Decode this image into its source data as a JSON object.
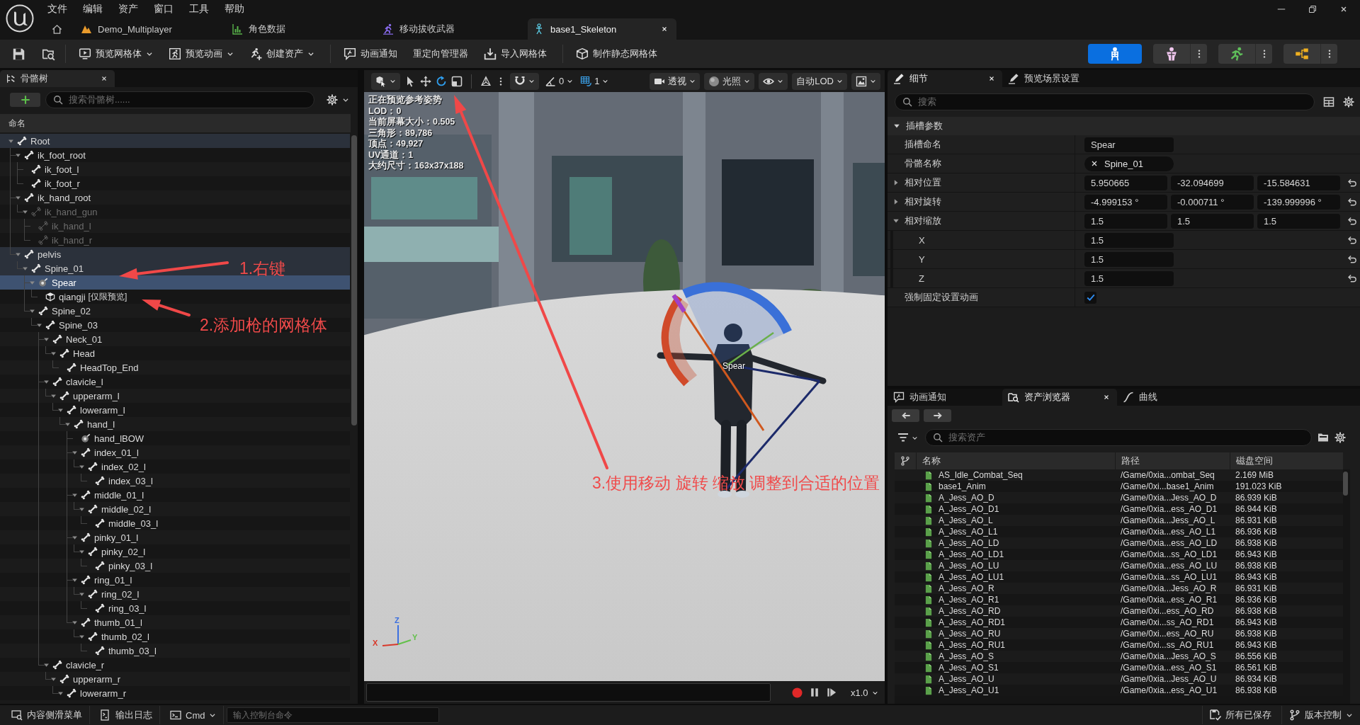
{
  "title_bar": {
    "menu": [
      "文件",
      "编辑",
      "资产",
      "窗口",
      "工具",
      "帮助"
    ],
    "tabs": [
      {
        "label": "Demo_Multiplayer",
        "kind": "level",
        "selected": false
      },
      {
        "label": "角色数据",
        "kind": "data",
        "selected": false
      },
      {
        "label": "移动拔收武器",
        "kind": "animation",
        "selected": false
      },
      {
        "label": "base1_Skeleton",
        "kind": "skeleton",
        "selected": true
      }
    ]
  },
  "toolbar": {
    "groups": [
      [
        {
          "label": "预览网格体",
          "kind": "mesh",
          "dropdown": true
        },
        {
          "label": "预览动画",
          "kind": "animation",
          "dropdown": true
        },
        {
          "label": "创建资产",
          "kind": "create",
          "dropdown": true
        }
      ],
      [
        {
          "label": "动画通知",
          "kind": "notify",
          "dropdown": false
        },
        {
          "label": "重定向管理器",
          "kind": "plain",
          "dropdown": false
        },
        {
          "label": "导入网格体",
          "kind": "import",
          "dropdown": false
        }
      ],
      [
        {
          "label": "制作静态网格体",
          "kind": "static",
          "dropdown": false
        }
      ]
    ],
    "modes": [
      {
        "kind": "skeleton",
        "selected": true
      },
      {
        "kind": "mesh",
        "selected": false
      },
      {
        "kind": "animation",
        "selected": false
      },
      {
        "kind": "blueprint",
        "selected": false
      }
    ]
  },
  "skeleton_tree": {
    "tab": "骨骼树",
    "search": {
      "placeholder": "搜索骨骼树......"
    },
    "column": "命名",
    "nodes": [
      {
        "name": "Root",
        "kind": "bone",
        "greyed": false,
        "selected": false,
        "expanded": true,
        "children": [
          {
            "name": "ik_foot_root",
            "kind": "bone",
            "greyed": false,
            "selected": false,
            "expanded": true,
            "children": [
              {
                "name": "ik_foot_l",
                "kind": "bone",
                "greyed": false,
                "selected": false
              },
              {
                "name": "ik_foot_r",
                "kind": "bone",
                "greyed": false,
                "selected": false
              }
            ]
          },
          {
            "name": "ik_hand_root",
            "kind": "bone",
            "greyed": false,
            "selected": false,
            "expanded": true,
            "children": [
              {
                "name": "ik_hand_gun",
                "kind": "bone",
                "greyed": true,
                "selected": false,
                "expanded": true,
                "children": [
                  {
                    "name": "ik_hand_l",
                    "kind": "bone",
                    "greyed": true,
                    "selected": false
                  },
                  {
                    "name": "ik_hand_r",
                    "kind": "bone",
                    "greyed": true,
                    "selected": false
                  }
                ]
              }
            ]
          },
          {
            "name": "pelvis",
            "kind": "bone",
            "greyed": false,
            "selected": false,
            "expanded": true,
            "children": [
              {
                "name": "Spine_01",
                "kind": "bone",
                "greyed": false,
                "selected": false,
                "expanded": true,
                "children": [
                  {
                    "name": "Spear",
                    "kind": "socket",
                    "greyed": false,
                    "selected": true,
                    "expanded": true,
                    "children": [
                      {
                        "name": "qiangji",
                        "tag": "[仅限预览]",
                        "kind": "mesh",
                        "greyed": false,
                        "selected": false
                      }
                    ]
                  },
                  {
                    "name": "Spine_02",
                    "kind": "bone",
                    "greyed": false,
                    "selected": false,
                    "expanded": true,
                    "children": [
                      {
                        "name": "Spine_03",
                        "kind": "bone",
                        "greyed": false,
                        "selected": false,
                        "expanded": true,
                        "children": [
                          {
                            "name": "Neck_01",
                            "kind": "bone",
                            "greyed": false,
                            "selected": false,
                            "expanded": true,
                            "children": [
                              {
                                "name": "Head",
                                "kind": "bone",
                                "greyed": false,
                                "selected": false,
                                "expanded": true,
                                "children": [
                                  {
                                    "name": "HeadTop_End",
                                    "kind": "bone",
                                    "greyed": false,
                                    "selected": false
                                  }
                                ]
                              }
                            ]
                          },
                          {
                            "name": "clavicle_l",
                            "kind": "bone",
                            "greyed": false,
                            "selected": false,
                            "expanded": true,
                            "children": [
                              {
                                "name": "upperarm_l",
                                "kind": "bone",
                                "greyed": false,
                                "selected": false,
                                "expanded": true,
                                "children": [
                                  {
                                    "name": "lowerarm_l",
                                    "kind": "bone",
                                    "greyed": false,
                                    "selected": false,
                                    "expanded": true,
                                    "children": [
                                      {
                                        "name": "hand_l",
                                        "kind": "bone",
                                        "greyed": false,
                                        "selected": false,
                                        "expanded": true,
                                        "children": [
                                          {
                                            "name": "hand_lBOW",
                                            "kind": "socket",
                                            "greyed": false,
                                            "selected": false
                                          },
                                          {
                                            "name": "index_01_l",
                                            "kind": "bone",
                                            "greyed": false,
                                            "selected": false,
                                            "expanded": true,
                                            "children": [
                                              {
                                                "name": "index_02_l",
                                                "kind": "bone",
                                                "greyed": false,
                                                "selected": false,
                                                "expanded": true,
                                                "children": [
                                                  {
                                                    "name": "index_03_l",
                                                    "kind": "bone",
                                                    "greyed": false,
                                                    "selected": false
                                                  }
                                                ]
                                              }
                                            ]
                                          },
                                          {
                                            "name": "middle_01_l",
                                            "kind": "bone",
                                            "greyed": false,
                                            "selected": false,
                                            "expanded": true,
                                            "children": [
                                              {
                                                "name": "middle_02_l",
                                                "kind": "bone",
                                                "greyed": false,
                                                "selected": false,
                                                "expanded": true,
                                                "children": [
                                                  {
                                                    "name": "middle_03_l",
                                                    "kind": "bone",
                                                    "greyed": false,
                                                    "selected": false
                                                  }
                                                ]
                                              }
                                            ]
                                          },
                                          {
                                            "name": "pinky_01_l",
                                            "kind": "bone",
                                            "greyed": false,
                                            "selected": false,
                                            "expanded": true,
                                            "children": [
                                              {
                                                "name": "pinky_02_l",
                                                "kind": "bone",
                                                "greyed": false,
                                                "selected": false,
                                                "expanded": true,
                                                "children": [
                                                  {
                                                    "name": "pinky_03_l",
                                                    "kind": "bone",
                                                    "greyed": false,
                                                    "selected": false
                                                  }
                                                ]
                                              }
                                            ]
                                          },
                                          {
                                            "name": "ring_01_l",
                                            "kind": "bone",
                                            "greyed": false,
                                            "selected": false,
                                            "expanded": true,
                                            "children": [
                                              {
                                                "name": "ring_02_l",
                                                "kind": "bone",
                                                "greyed": false,
                                                "selected": false,
                                                "expanded": true,
                                                "children": [
                                                  {
                                                    "name": "ring_03_l",
                                                    "kind": "bone",
                                                    "greyed": false,
                                                    "selected": false
                                                  }
                                                ]
                                              }
                                            ]
                                          },
                                          {
                                            "name": "thumb_01_l",
                                            "kind": "bone",
                                            "greyed": false,
                                            "selected": false,
                                            "expanded": true,
                                            "children": [
                                              {
                                                "name": "thumb_02_l",
                                                "kind": "bone",
                                                "greyed": false,
                                                "selected": false,
                                                "expanded": true,
                                                "children": [
                                                  {
                                                    "name": "thumb_03_l",
                                                    "kind": "bone",
                                                    "greyed": false,
                                                    "selected": false
                                                  }
                                                ]
                                              }
                                            ]
                                          }
                                        ]
                                      }
                                    ]
                                  }
                                ]
                              }
                            ]
                          },
                          {
                            "name": "clavicle_r",
                            "kind": "bone",
                            "greyed": false,
                            "selected": false,
                            "expanded": true,
                            "children": [
                              {
                                "name": "upperarm_r",
                                "kind": "bone",
                                "greyed": false,
                                "selected": false,
                                "expanded": true,
                                "children": [
                                  {
                                    "name": "lowerarm_r",
                                    "kind": "bone",
                                    "greyed": false,
                                    "selected": false,
                                    "expanded": true
                                  }
                                ]
                              }
                            ]
                          }
                        ]
                      }
                    ]
                  }
                ]
              }
            ]
          }
        ]
      }
    ]
  },
  "viewport": {
    "tools": [
      {
        "kind": "select",
        "selected": false
      },
      {
        "kind": "move",
        "selected": false
      },
      {
        "kind": "rotate",
        "selected": true
      },
      {
        "kind": "scale",
        "selected": false
      }
    ],
    "angle_snap": "0",
    "grid_snap": "1",
    "view_buttons": [
      {
        "kind": "camera",
        "label": "透视"
      },
      {
        "kind": "lighting",
        "label": "光照"
      },
      {
        "kind": "show"
      },
      {
        "kind": "lod",
        "label": "自动LOD"
      },
      {
        "kind": "screen"
      }
    ],
    "stats": [
      "正在预览参考姿势",
      "LOD：0",
      "当前屏幕大小：0.505",
      "三角形：89,786",
      "顶点：49,927",
      "UV通道：1",
      "大约尺寸：163x37x188"
    ],
    "socket_label": "Spear",
    "axes": [
      {
        "label": "Z",
        "color": "#3b6fe0"
      },
      {
        "label": "X",
        "color": "#d8382a"
      },
      {
        "label": "Y",
        "color": "#62c04a"
      }
    ],
    "playback": {
      "speed": "x1.0"
    }
  },
  "details": {
    "tabs": [
      {
        "label": "细节",
        "selected": true
      },
      {
        "label": "预览场景设置",
        "selected": false
      }
    ],
    "search": {
      "placeholder": "搜索"
    },
    "section": {
      "title": "插槽参数",
      "expanded": true
    },
    "properties": [
      {
        "kind": "text",
        "label": "插槽命名",
        "value": "Spear",
        "modified": false
      },
      {
        "kind": "bone",
        "label": "骨骼名称",
        "value": "Spine_01",
        "modified": false
      },
      {
        "kind": "vector",
        "label": "相对位置",
        "expanded": false,
        "values": [
          "5.950665",
          "-32.094699",
          "-15.584631"
        ],
        "modified": true
      },
      {
        "kind": "vector",
        "label": "相对旋转",
        "expanded": false,
        "values": [
          "-4.999153 °",
          "-0.000711 °",
          "-139.999996 °"
        ],
        "modified": true
      },
      {
        "kind": "vector",
        "label": "相对缩放",
        "expanded": true,
        "values": [
          "1.5",
          "1.5",
          "1.5"
        ],
        "modified": true,
        "children": [
          {
            "kind": "scalar",
            "label": "X",
            "value": "1.5",
            "modified": true
          },
          {
            "kind": "scalar",
            "label": "Y",
            "value": "1.5",
            "modified": true
          },
          {
            "kind": "scalar",
            "label": "Z",
            "value": "1.5",
            "modified": true
          }
        ]
      },
      {
        "kind": "checkbox",
        "label": "强制固定设置动画",
        "checked": true,
        "modified": false
      }
    ]
  },
  "asset_browser": {
    "tabs": [
      {
        "label": "动画通知",
        "kind": "notify",
        "selected": false
      },
      {
        "label": "资产浏览器",
        "kind": "browser",
        "selected": true
      },
      {
        "label": "曲线",
        "kind": "curve",
        "selected": false
      }
    ],
    "search": {
      "placeholder": "搜索资产"
    },
    "columns": [
      "名称",
      "路径",
      "磁盘空间"
    ],
    "rows": [
      {
        "name": "AS_Idle_Combat_Seq",
        "path": "/Game/0xia...ombat_Seq",
        "size": "2.169 MiB",
        "selected": false
      },
      {
        "name": "base1_Anim",
        "path": "/Game/0xi...base1_Anim",
        "size": "191.023 KiB",
        "selected": false
      },
      {
        "name": "A_Jess_AO_D",
        "path": "/Game/0xia...Jess_AO_D",
        "size": "86.939 KiB",
        "selected": false
      },
      {
        "name": "A_Jess_AO_D1",
        "path": "/Game/0xia...ess_AO_D1",
        "size": "86.944 KiB",
        "selected": false
      },
      {
        "name": "A_Jess_AO_L",
        "path": "/Game/0xia...Jess_AO_L",
        "size": "86.931 KiB",
        "selected": false
      },
      {
        "name": "A_Jess_AO_L1",
        "path": "/Game/0xia...ess_AO_L1",
        "size": "86.936 KiB",
        "selected": false
      },
      {
        "name": "A_Jess_AO_LD",
        "path": "/Game/0xia...ess_AO_LD",
        "size": "86.938 KiB",
        "selected": false
      },
      {
        "name": "A_Jess_AO_LD1",
        "path": "/Game/0xia...ss_AO_LD1",
        "size": "86.943 KiB",
        "selected": false
      },
      {
        "name": "A_Jess_AO_LU",
        "path": "/Game/0xia...ess_AO_LU",
        "size": "86.938 KiB",
        "selected": false
      },
      {
        "name": "A_Jess_AO_LU1",
        "path": "/Game/0xia...ss_AO_LU1",
        "size": "86.943 KiB",
        "selected": false
      },
      {
        "name": "A_Jess_AO_R",
        "path": "/Game/0xia...Jess_AO_R",
        "size": "86.931 KiB",
        "selected": false
      },
      {
        "name": "A_Jess_AO_R1",
        "path": "/Game/0xia...ess_AO_R1",
        "size": "86.936 KiB",
        "selected": false
      },
      {
        "name": "A_Jess_AO_RD",
        "path": "/Game/0xi...ess_AO_RD",
        "size": "86.938 KiB",
        "selected": false
      },
      {
        "name": "A_Jess_AO_RD1",
        "path": "/Game/0xi...ss_AO_RD1",
        "size": "86.943 KiB",
        "selected": false
      },
      {
        "name": "A_Jess_AO_RU",
        "path": "/Game/0xi...ess_AO_RU",
        "size": "86.938 KiB",
        "selected": false
      },
      {
        "name": "A_Jess_AO_RU1",
        "path": "/Game/0xi...ss_AO_RU1",
        "size": "86.943 KiB",
        "selected": false
      },
      {
        "name": "A_Jess_AO_S",
        "path": "/Game/0xia...Jess_AO_S",
        "size": "86.556 KiB",
        "selected": false
      },
      {
        "name": "A_Jess_AO_S1",
        "path": "/Game/0xia...ess_AO_S1",
        "size": "86.561 KiB",
        "selected": false
      },
      {
        "name": "A_Jess_AO_U",
        "path": "/Game/0xia...Jess_AO_U",
        "size": "86.934 KiB",
        "selected": false
      },
      {
        "name": "A_Jess_AO_U1",
        "path": "/Game/0xia...ess_AO_U1",
        "size": "86.938 KiB",
        "selected": false
      }
    ]
  },
  "status_bar": {
    "items": [
      {
        "label": "内容侧滑菜单",
        "kind": "drawer",
        "dropdown": false
      },
      {
        "label": "输出日志",
        "kind": "log",
        "dropdown": false
      },
      {
        "label": "Cmd",
        "kind": "cmd",
        "dropdown": true
      }
    ],
    "console": {
      "placeholder": "输入控制台命令"
    },
    "right": [
      {
        "label": "所有已保存",
        "kind": "save",
        "dropdown": false
      },
      {
        "label": "版本控制",
        "kind": "source",
        "dropdown": true
      }
    ]
  },
  "annotations": [
    {
      "text": "1.右键"
    },
    {
      "text": "2.添加枪的网格体"
    },
    {
      "text": "3.使用移动 旋转 缩放 调整到合适的位置"
    }
  ]
}
